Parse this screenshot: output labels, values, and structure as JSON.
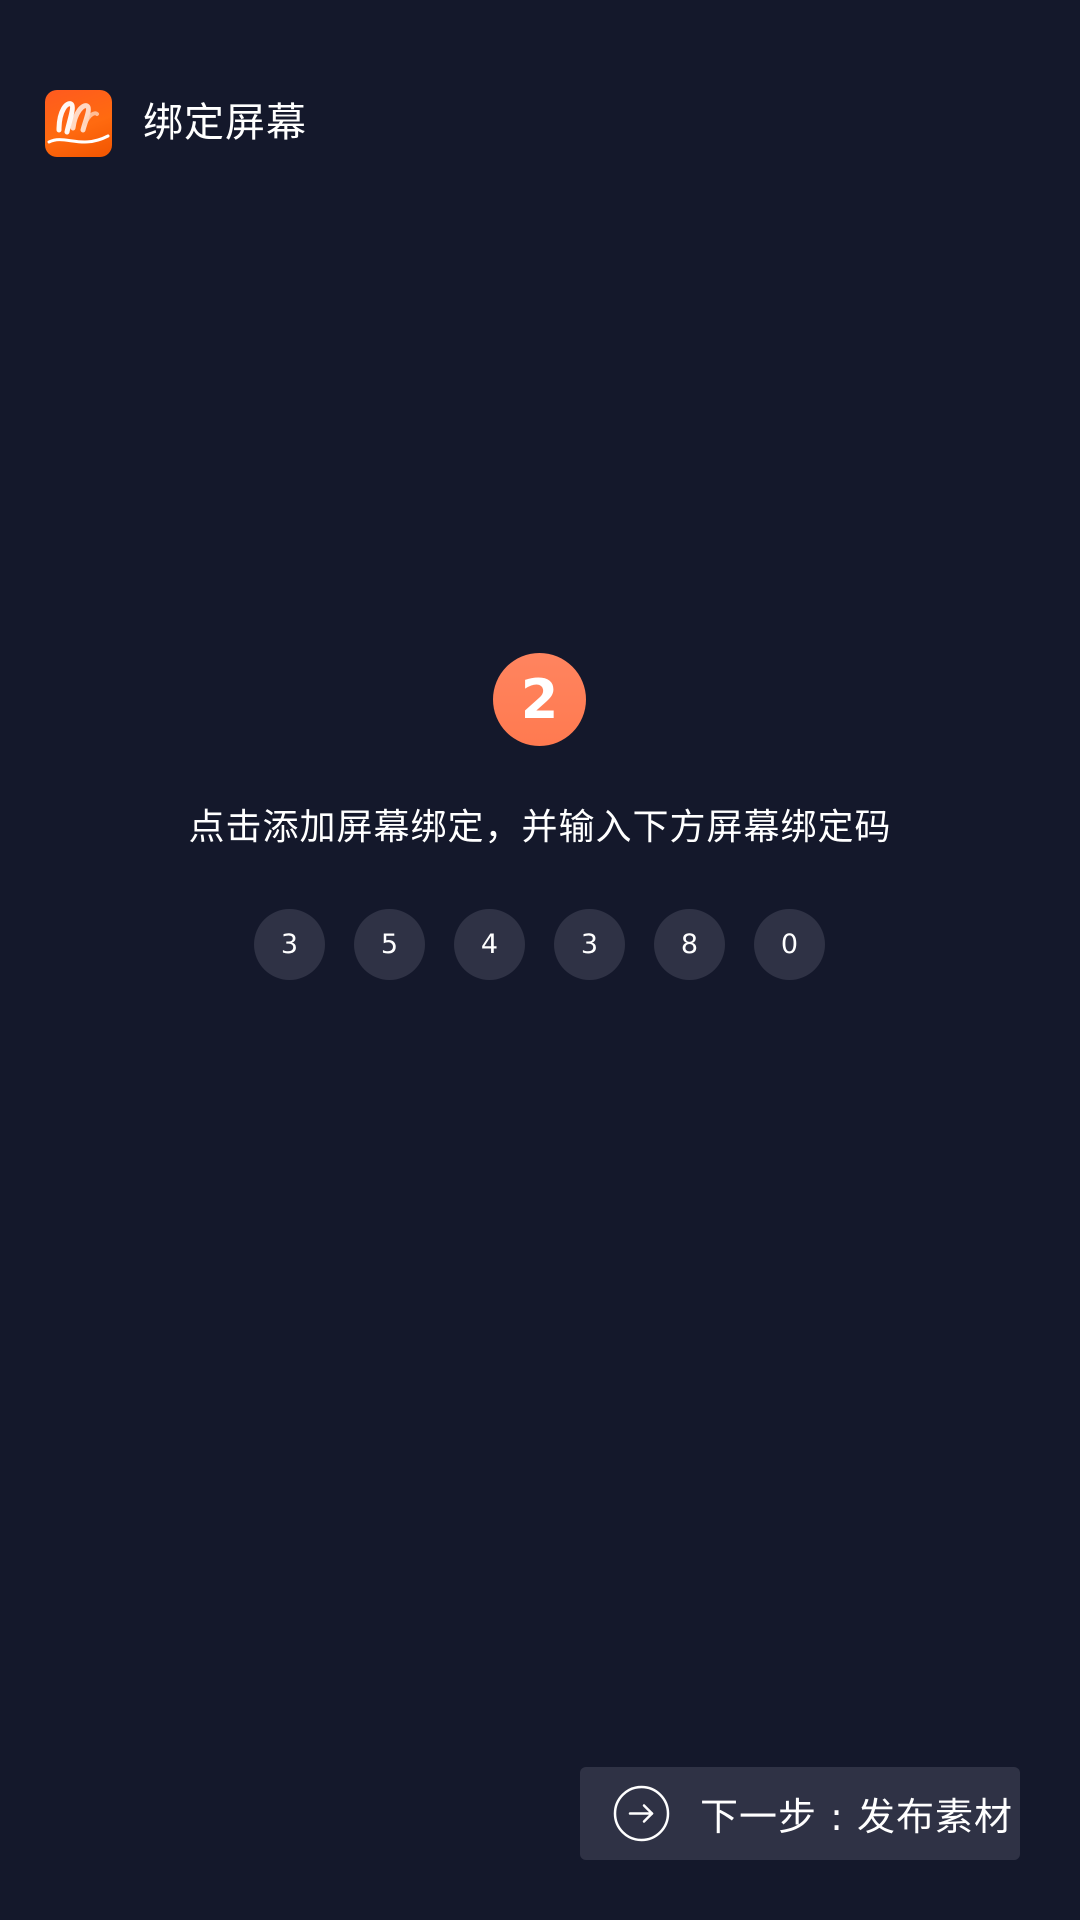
{
  "header": {
    "logo_icon": "app-logo-icon",
    "title": "绑定屏幕"
  },
  "step": {
    "number": "2"
  },
  "instruction": {
    "text": "点击添加屏幕绑定，并输入下方屏幕绑定码"
  },
  "binding_code": {
    "digits": [
      "3",
      "5",
      "4",
      "3",
      "8",
      "0"
    ]
  },
  "next_button": {
    "icon": "arrow-right-circle-icon",
    "label": "下一步 : 发布素材"
  },
  "colors": {
    "background": "#14182b",
    "accent": "#ff7a50",
    "logo": "#ff5a1f",
    "surface": "#2f3245",
    "text": "#ffffff"
  }
}
